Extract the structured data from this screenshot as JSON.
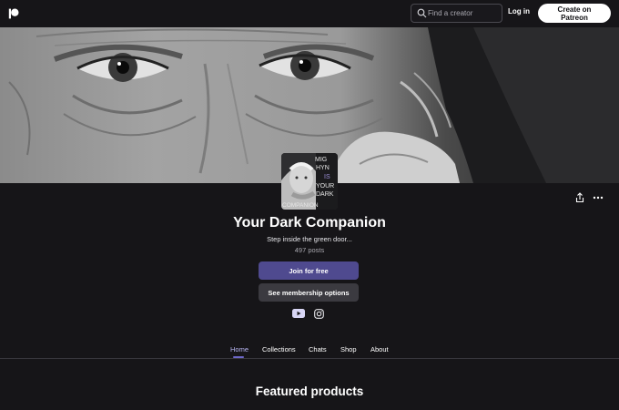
{
  "header": {
    "logo_icon": "patreon-logo-icon",
    "search": {
      "placeholder": "Find a creator",
      "value": ""
    },
    "login_label": "Log in",
    "create_label": "Create on Patreon"
  },
  "creator": {
    "name": "Your Dark Companion",
    "tagline": "Step inside the green door...",
    "post_count": "497 posts",
    "avatar_text": [
      "MIG",
      "HYN",
      "IS",
      "YOUR",
      "DARK",
      "COMPANION"
    ]
  },
  "actions": {
    "share_icon": "share-icon",
    "more_icon": "more-options-icon",
    "join_label": "Join for free",
    "membership_label": "See membership options"
  },
  "social": [
    "youtube-icon",
    "instagram-icon"
  ],
  "tabs": [
    {
      "label": "Home",
      "active": true
    },
    {
      "label": "Collections",
      "active": false
    },
    {
      "label": "Chats",
      "active": false
    },
    {
      "label": "Shop",
      "active": false
    },
    {
      "label": "About",
      "active": false
    }
  ],
  "section": {
    "title": "Featured products"
  },
  "colors": {
    "background": "#161518",
    "primary_button": "#4f4a8f",
    "secondary_button": "#3b3a40",
    "active_tab": "#b6b4f0"
  }
}
